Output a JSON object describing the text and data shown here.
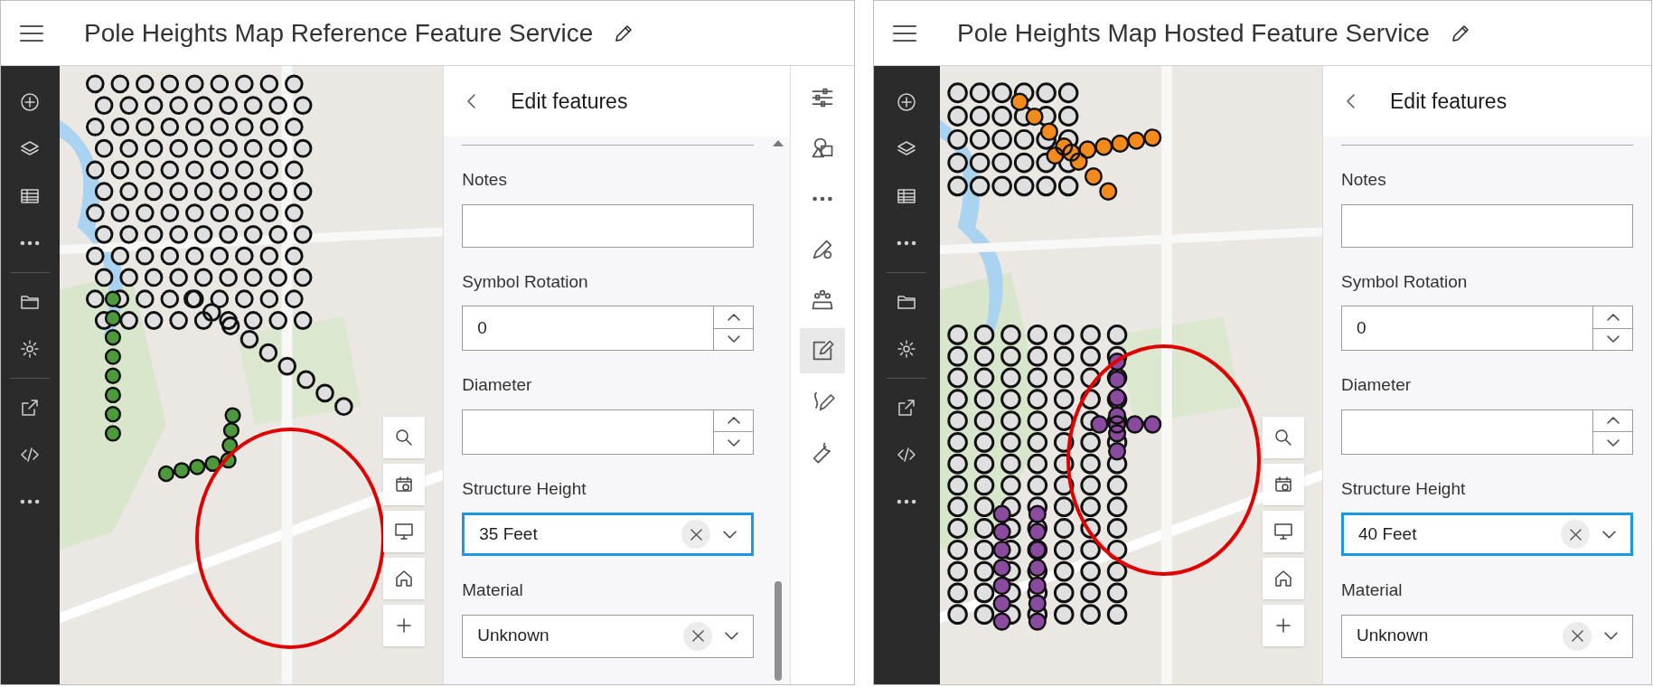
{
  "windows": [
    {
      "title": "Pole Heights Map Reference Feature Service",
      "panel": {
        "title": "Edit features",
        "scrollbar": true,
        "fields": [
          {
            "kind": "text",
            "label": "Notes"
          },
          {
            "kind": "number",
            "label": "Symbol Rotation",
            "value": "0"
          },
          {
            "kind": "number",
            "label": "Diameter"
          },
          {
            "kind": "select",
            "label": "Structure Height",
            "value": "35 Feet",
            "focused": true
          },
          {
            "kind": "select",
            "label": "Material",
            "value": "Unknown",
            "focused": false
          }
        ]
      },
      "action_bar": [
        {
          "kind": "sliders",
          "selected": false
        },
        {
          "kind": "shapes",
          "selected": false
        },
        {
          "kind": "more",
          "selected": false
        },
        {
          "kind": "pencil-gear",
          "selected": false
        },
        {
          "kind": "people",
          "selected": false
        },
        {
          "kind": "edit",
          "selected": true
        },
        {
          "kind": "pen-curve",
          "selected": false
        },
        {
          "kind": "wrench",
          "selected": false
        }
      ]
    },
    {
      "title": "Pole Heights Map Hosted Feature Service",
      "panel": {
        "title": "Edit features",
        "scrollbar": false,
        "fields": [
          {
            "kind": "text",
            "label": "Notes"
          },
          {
            "kind": "number",
            "label": "Symbol Rotation",
            "value": "0"
          },
          {
            "kind": "number",
            "label": "Diameter"
          },
          {
            "kind": "select",
            "label": "Structure Height",
            "value": "40 Feet",
            "focused": true
          },
          {
            "kind": "select",
            "label": "Material",
            "value": "Unknown",
            "focused": false
          }
        ]
      }
    }
  ]
}
